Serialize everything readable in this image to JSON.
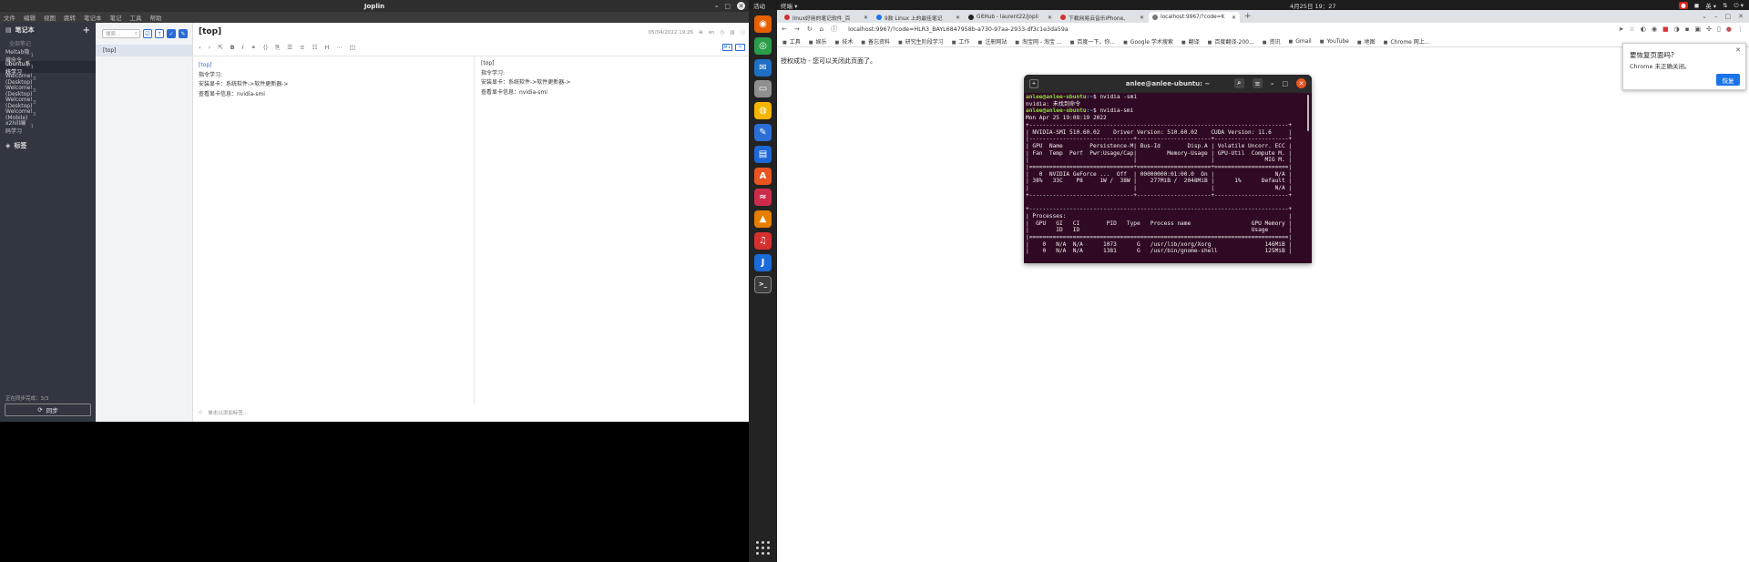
{
  "joplin": {
    "window_title": "Joplin",
    "menu": [
      "文件",
      "编辑",
      "视图",
      "跳转",
      "笔记本",
      "笔记",
      "工具",
      "帮助"
    ],
    "sidebar": {
      "header": "笔记本",
      "all_notes": "全部笔记",
      "notebooks": [
        {
          "name": "Meltab隐藏命令",
          "count": "1"
        },
        {
          "name": "ubuntu系统学习",
          "count": "1",
          "selected": true
        },
        {
          "name": "Welcome! (Desktop)",
          "count": "3"
        },
        {
          "name": "Welcome! (Desktop)",
          "count": "3"
        },
        {
          "name": "Welcome! (Desktop)",
          "count": "3"
        },
        {
          "name": "Welcome! (Mobile)",
          "count": "3"
        },
        {
          "name": "x2hill编码学习",
          "count": "1"
        }
      ],
      "tags_label": "标签",
      "sync_status": "正在同步完成：3/3",
      "sync_button": "同步"
    },
    "note_list": {
      "search_placeholder": "搜索...",
      "notes": [
        "[top]"
      ]
    },
    "editor": {
      "title": "[top]",
      "timestamp": "05/04/2022 19:26",
      "lang": "en",
      "lines": [
        "[top]",
        "指令学习:",
        "安装显卡：系统软件->软件更新器->",
        "查看显卡信息：nvidia-smi"
      ],
      "tag_hint": "单击以添加标签..."
    }
  },
  "ubuntu": {
    "activities": "活动",
    "app": "终端 ▾",
    "clock": "4月25日  19：27",
    "tray": [
      "英 ▾",
      "⏻ ▾"
    ],
    "dock": [
      {
        "icon": "firefox-icon",
        "color": "#e66000"
      },
      {
        "icon": "chrome-icon",
        "color": "#2a9d4a"
      },
      {
        "icon": "thunderbird-icon",
        "color": "#1f6fc5"
      },
      {
        "icon": "files-icon",
        "color": "#8f8f8f"
      },
      {
        "icon": "rhythmbox-icon",
        "color": "#f5b400"
      },
      {
        "icon": "text-editor-icon",
        "color": "#2b6fd6"
      },
      {
        "icon": "libreoffice-writer-icon",
        "color": "#1c68d6"
      },
      {
        "icon": "software-center-icon",
        "color": "#e95420"
      },
      {
        "icon": "guake-icon",
        "color": "#cc2c4a"
      },
      {
        "icon": "vlc-icon",
        "color": "#e67e00"
      },
      {
        "icon": "netease-music-icon",
        "color": "#d6302e"
      },
      {
        "icon": "joplin-icon",
        "color": "#1a6bd8"
      },
      {
        "icon": "terminal-icon",
        "color": "#3c3c3c"
      }
    ]
  },
  "chrome": {
    "tabs": [
      {
        "title": "linux好用的笔记软件_百",
        "color": "#c33"
      },
      {
        "title": "9款 Linux 上的最佳笔记",
        "color": "#1a73e8"
      },
      {
        "title": "GitHub - laurent22/jopli",
        "color": "#222"
      },
      {
        "title": "下载网易云音乐iPhone、",
        "color": "#d6302e"
      },
      {
        "title": "localhost:9967/?code=K",
        "color": "#777",
        "active": true
      }
    ],
    "url": "localhost:9967/?code=HLR3_BAYL6847958b-a730-97aa-2933-df3c1e3da59a",
    "bookmarks": [
      "工具",
      "娱乐",
      "技术",
      "备忘资料",
      "研究生阶段学习",
      "工作",
      "注册网站",
      "淘宝网 - 淘宝 ...",
      "百度一下，你...",
      "Google 学术搜索",
      "翻译",
      "百度翻译-200...",
      "资讯",
      "Gmail",
      "YouTube",
      "地图",
      "Chrome 网上..."
    ],
    "page_message": "授权成功 - 您可以关闭此页面了。",
    "restore_popup": {
      "title": "要恢复页面吗?",
      "subtitle": "Chrome 未正确关闭。",
      "button": "恢复"
    }
  },
  "terminal": {
    "title": "anlee@anlee-ubuntu: ~",
    "prompt_user": "anlee@anlee-ubuntu",
    "prompt_path": ":~",
    "cmd1": "$ nvidia -smi",
    "out1": "nvidia: 未找到命令",
    "cmd2": "$ nvidia-smi",
    "output": "Mon Apr 25 19:08:19 2022\n+-----------------------------------------------------------------------------+\n| NVIDIA-SMI 510.60.02    Driver Version: 510.60.02    CUDA Version: 11.6     |\n|-------------------------------+----------------------+----------------------+\n| GPU  Name        Persistence-M| Bus-Id        Disp.A | Volatile Uncorr. ECC |\n| Fan  Temp  Perf  Pwr:Usage/Cap|         Memory-Usage | GPU-Util  Compute M. |\n|                               |                      |               MIG M. |\n|===============================+======================+======================|\n|   0  NVIDIA GeForce ...  Off  | 00000000:01:00.0  On |                  N/A |\n| 38%   33C    P8     1W /  38W |    277MiB /  2048MiB |      1%      Default |\n|                               |                      |                  N/A |\n+-------------------------------+----------------------+----------------------+\n\n+-----------------------------------------------------------------------------+\n| Processes:                                                                  |\n|  GPU   GI   CI        PID   Type   Process name                  GPU Memory |\n|        ID   ID                                                   Usage      |\n|=============================================================================|\n|    0   N/A  N/A      1073      G   /usr/lib/xorg/Xorg                146MiB |\n|    0   N/A  N/A      1381      G   /usr/bin/gnome-shell              125MiB |"
  }
}
